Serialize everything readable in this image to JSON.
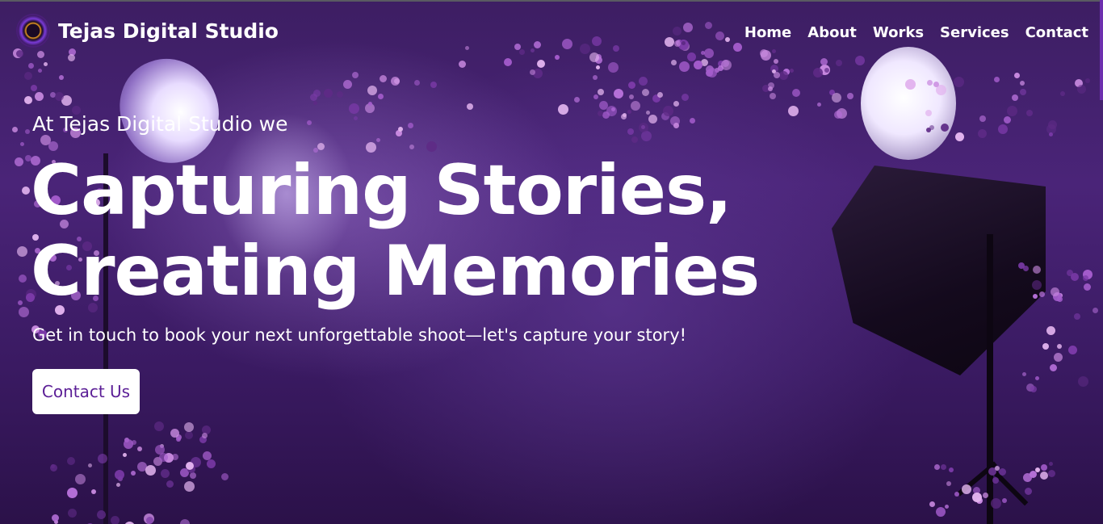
{
  "nav": {
    "brand_name": "Tejas Digital Studio",
    "logo_icon": "camera-lens-logo-icon",
    "items": [
      {
        "label": "Home"
      },
      {
        "label": "About"
      },
      {
        "label": "Works"
      },
      {
        "label": "Services"
      },
      {
        "label": "Contact"
      }
    ]
  },
  "hero": {
    "eyebrow": "At Tejas Digital Studio we",
    "headline": "Capturing Stories, Creating Memories",
    "subtext": "Get in touch to book your next unforgettable shoot—let's capture your story!",
    "cta_label": "Contact Us"
  },
  "colors": {
    "background": "#3d1e63",
    "accent": "#5b1e96",
    "text": "#ffffff",
    "button_bg": "#ffffff"
  }
}
